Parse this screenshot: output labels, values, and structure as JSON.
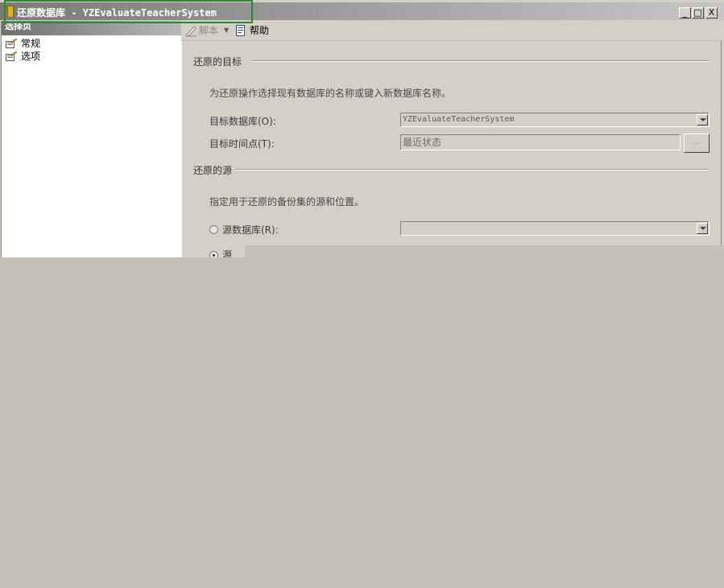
{
  "window": {
    "title": "还原数据库 - YZEvaluateTeacherSystem",
    "buttons": {
      "minimize": "_",
      "maximize": "□",
      "close": "X"
    }
  },
  "sidebar": {
    "header": "选择页",
    "items": [
      {
        "label": "常规",
        "icon": "page-settings-icon"
      },
      {
        "label": "选项",
        "icon": "page-settings-icon"
      }
    ]
  },
  "toolbar": {
    "script_label": "脚本",
    "help_label": "帮助"
  },
  "target": {
    "section_title": "还原的目标",
    "hint": "为还原操作选择现有数据库的名称或键入新数据库名称。",
    "database_label": "目标数据库(O):",
    "database_value": "YZEvaluateTeacherSystem",
    "time_label": "目标时间点(T):",
    "time_value": "最近状态",
    "browse_label": "..."
  },
  "source": {
    "section_title": "还原的源",
    "hint": "指定用于还原的备份集的源和位置。",
    "source_db_label": "源数据库(R):",
    "source_db_value": "",
    "source_device_label": "源"
  },
  "colors": {
    "highlight_border": "#2b8a2b",
    "background": "#c4c1bb",
    "dialog": "#d4d0c8"
  }
}
